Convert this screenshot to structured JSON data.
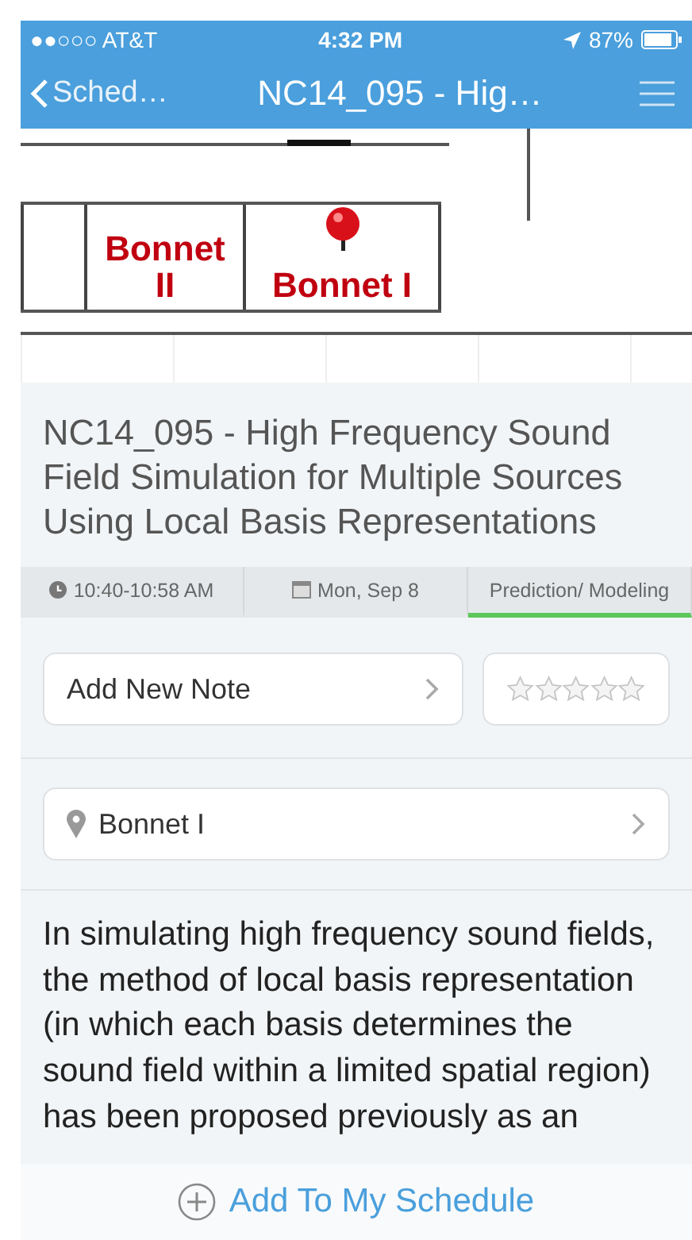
{
  "status_bar": {
    "carrier": "●●○○○ AT&T",
    "time": "4:32 PM",
    "battery": "87%"
  },
  "nav_bar": {
    "back": "Sched…",
    "title": "NC14_095 - Hig…"
  },
  "floor_plan": {
    "rooms": [
      {
        "label": "Bonnet II",
        "pinned": false
      },
      {
        "label": "Bonnet I",
        "pinned": true
      }
    ]
  },
  "session": {
    "title": "NC14_095 - High Frequency Sound Field Simulation for Multiple Sources Using Local Basis Representations"
  },
  "info_tabs": [
    {
      "kind": "time",
      "label": "10:40-10:58 AM",
      "selected": false
    },
    {
      "kind": "date",
      "label": "Mon, Sep 8",
      "selected": false
    },
    {
      "kind": "topic",
      "label": "Prediction/ Modeling",
      "selected": true
    }
  ],
  "note_button": "Add New Note",
  "rating": {
    "stars": 0
  },
  "location": "Bonnet I",
  "abstract": "In simulating high frequency sound fields, the method of local basis representation (in which each basis determines the sound field within a limited spatial region) has been proposed previously as an",
  "schedule_button": "Add To My Schedule"
}
